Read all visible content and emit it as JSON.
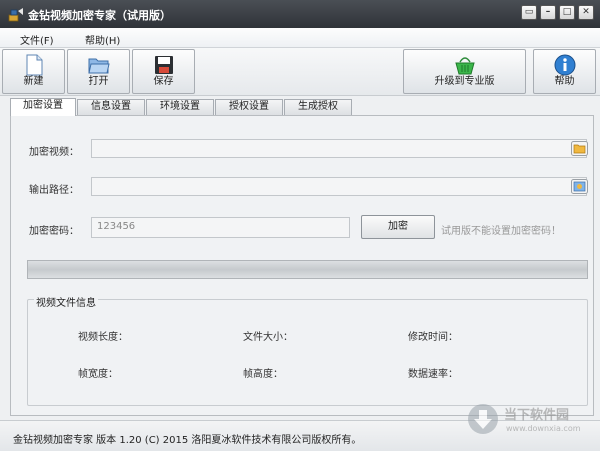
{
  "window": {
    "title": "金钻视频加密专家（试用版）",
    "controls": [
      "▭",
      "–",
      "□",
      "✕"
    ]
  },
  "menu": {
    "file": "文件(F)",
    "help": "帮助(H)"
  },
  "toolbar": {
    "new_label": "新建",
    "open_label": "打开",
    "save_label": "保存",
    "upgrade_label": "升级到专业版",
    "help_label": "帮助"
  },
  "tabs": [
    "加密设置",
    "信息设置",
    "环境设置",
    "授权设置",
    "生成授权"
  ],
  "form": {
    "video_label": "加密视频：",
    "video_value": "",
    "output_label": "输出路径：",
    "output_value": "",
    "password_label": "加密密码：",
    "password_value": "123456",
    "encrypt_button": "加密",
    "trial_note": "试用版不能设置加密密码！"
  },
  "progress": {
    "value": 0
  },
  "video_info": {
    "title": "视频文件信息",
    "length": "视频长度：",
    "file_size": "文件大小：",
    "modified": "修改时间：",
    "frame_width": "帧宽度：",
    "frame_height": "帧高度：",
    "data_rate": "数据速率："
  },
  "status": {
    "text": "金钻视频加密专家 版本 1.20 (C) 2015 洛阳夏冰软件技术有限公司版权所有。"
  },
  "watermark": {
    "name": "当下软件园",
    "url": "www.downxia.com"
  },
  "colors": {
    "titlebar": "#2f3338",
    "panel": "#f0f2f4",
    "accent_green": "#3bb54a",
    "info_blue": "#2f7fd1"
  }
}
